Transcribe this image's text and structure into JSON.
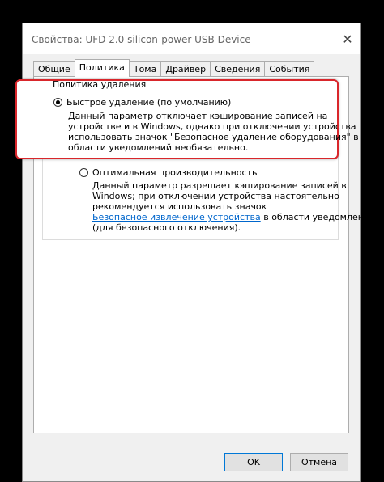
{
  "window": {
    "title": "Свойства: UFD 2.0 silicon-power USB Device",
    "close_glyph": "✕"
  },
  "tabs": [
    {
      "label": "Общие",
      "active": false
    },
    {
      "label": "Политика",
      "active": true
    },
    {
      "label": "Тома",
      "active": false
    },
    {
      "label": "Драйвер",
      "active": false
    },
    {
      "label": "Сведения",
      "active": false
    },
    {
      "label": "События",
      "active": false
    }
  ],
  "policy": {
    "group_title": "Политика удаления",
    "quick": {
      "label": "Быстрое удаление (по умолчанию)",
      "selected": true,
      "desc": [
        "Данный параметр отключает кэширование записей на",
        "устройстве и в Windows, однако при отключении устройства",
        "использовать значок \"Безопасное удаление оборудования\" в",
        "области уведомлений необязательно."
      ]
    },
    "optimal": {
      "label": "Оптимальная производительность",
      "selected": false,
      "desc": [
        "Данный параметр разрешает кэширование записей в",
        "Windows; при отключении устройства настоятельно",
        "рекомендуется использовать значок"
      ],
      "link": "Безопасное извлечение устройства",
      "desc_after_link": " в области уведомлений",
      "desc_last": "(для безопасного отключения)."
    }
  },
  "buttons": {
    "ok": "OK",
    "cancel": "Отмена"
  },
  "colors": {
    "highlight": "#d9262b",
    "link": "#0066cc"
  }
}
